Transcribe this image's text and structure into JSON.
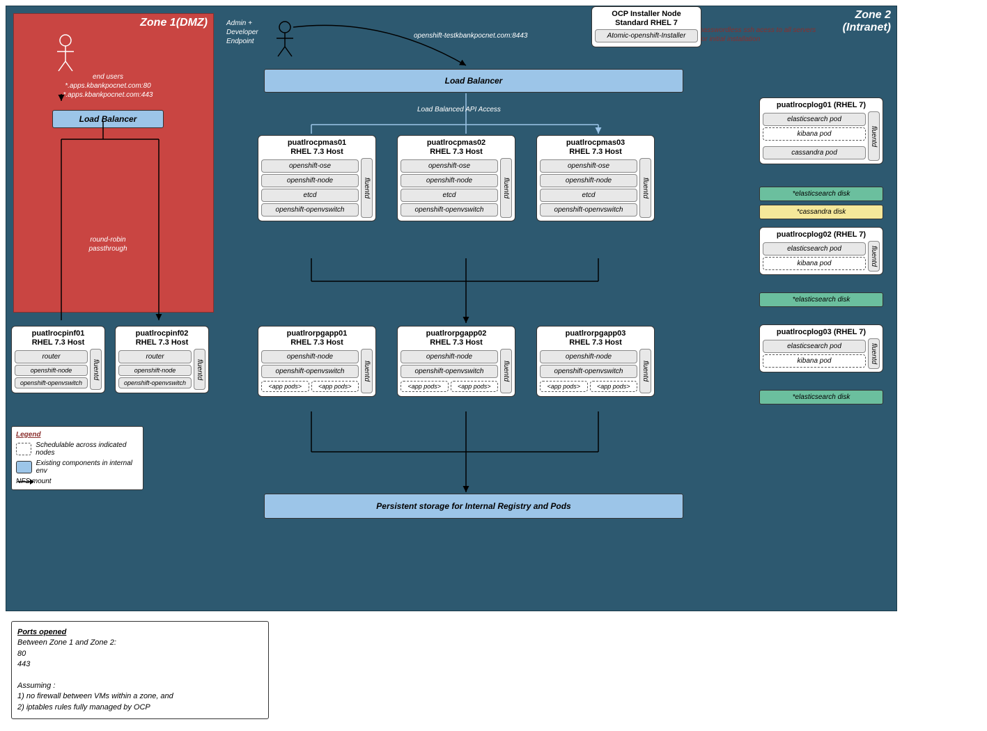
{
  "zone1": {
    "title": "Zone 1(DMZ)",
    "end_users": "end users",
    "host1": "*.apps.kbankpocnet.com:80",
    "host2": "*.apps.kbankpocnet.com:443",
    "lb": "Load Balancer",
    "rr1": "round-robin",
    "rr2": "passthrough"
  },
  "zone2": {
    "title": "Zone 2\n(Intranet)",
    "admin": "Admin +\nDeveloper\nEndpoint",
    "api_url": "openshift-testkbankpocnet.com:8443",
    "lb": "Load Balancer",
    "lb_caption": "Load Balanced API Access",
    "ssh": "passwordless ssh acess to all servers for initial installation",
    "storage": "Persistent storage for Internal Registry and Pods"
  },
  "installer": {
    "t1": "OCP Installer Node",
    "t2": "Standard RHEL 7",
    "pod": "Atomic-openshift-Installer"
  },
  "master": {
    "names": [
      "puatlrocpmas01",
      "puatlrocpmas02",
      "puatlrocpmas03"
    ],
    "sub": "RHEL 7.3 Host",
    "pods": [
      "openshift-ose",
      "openshift-node",
      "etcd",
      "openshift-openvswitch"
    ],
    "fluentd": "fluentd"
  },
  "app": {
    "names": [
      "puatlrorpgapp01",
      "puatlrorpgapp02",
      "puatlrorpgapp03"
    ],
    "sub": "RHEL 7.3 Host",
    "pods": [
      "openshift-node",
      "openshift-openvswitch"
    ],
    "sp": "<app pods>",
    "fluentd": "fluentd"
  },
  "inf": {
    "names": [
      "puatlrocpinf01",
      "puatlrocpinf02"
    ],
    "sub": "RHEL 7.3 Host",
    "pods": [
      "router",
      "openshift-node",
      "openshift-openvswitch"
    ],
    "fluentd": "fluentd"
  },
  "log": {
    "names": [
      "puatlrocplog01 (RHEL 7)",
      "puatlrocplog02 (RHEL 7)",
      "puatlrocplog03 (RHEL 7)"
    ],
    "es": "elasticsearch pod",
    "kb": "kibana pod",
    "cs": "cassandra pod",
    "fluentd": "fluentd",
    "esd": "*elasticsearch disk",
    "csd": "*cassandra disk"
  },
  "legend": {
    "title": "Legend",
    "s": "Schedulable across indicated nodes",
    "e": "Existing components in internal env",
    "n": "NFS mount"
  },
  "ports": {
    "title": "Ports opened",
    "l1": "Between Zone 1 and Zone 2:",
    "l2": "80",
    "l3": "443",
    "a": "Assuming :",
    "a1": "1) no firewall between VMs within a zone, and",
    "a2": "2) iptables rules fully managed by OCP"
  }
}
